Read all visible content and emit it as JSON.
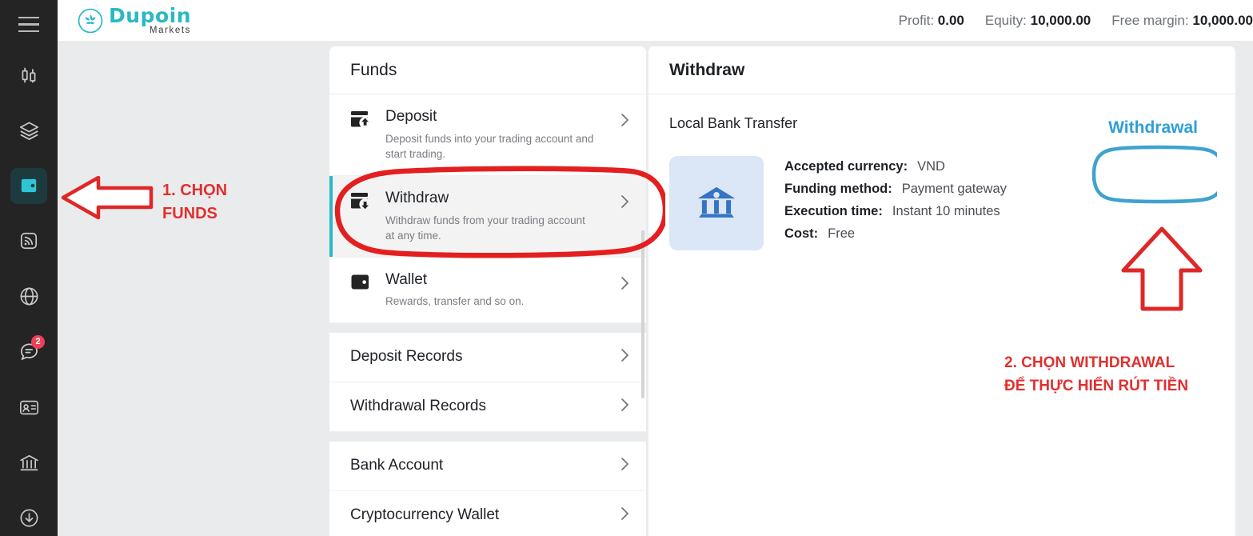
{
  "brand": {
    "name": "Dupoin",
    "sub": "Markets",
    "color": "#29b9c4"
  },
  "header": {
    "menu_icon": "hamburger-icon",
    "stats": [
      {
        "label": "Profit:",
        "value": "0.00"
      },
      {
        "label": "Equity:",
        "value": "10,000.00"
      },
      {
        "label": "Free margin:",
        "value": "10,000.00"
      }
    ]
  },
  "sidebar": {
    "items": [
      {
        "icon": "candlestick-chart-icon",
        "active": false
      },
      {
        "icon": "layers-icon",
        "active": false
      },
      {
        "icon": "wallet-icon",
        "active": true
      },
      {
        "icon": "signal-icon",
        "active": false
      },
      {
        "icon": "globe-icon",
        "active": false
      },
      {
        "icon": "chat-icon",
        "active": false,
        "badge": "2"
      },
      {
        "icon": "id-card-icon",
        "active": false
      },
      {
        "icon": "bank-icon",
        "active": false
      },
      {
        "icon": "download-circle-icon",
        "active": false
      }
    ]
  },
  "funds": {
    "title": "Funds",
    "primary_items": [
      {
        "icon": "deposit-icon",
        "title": "Deposit",
        "desc": "Deposit funds into your trading account and start trading.",
        "selected": false
      },
      {
        "icon": "withdraw-icon",
        "title": "Withdraw",
        "desc": "Withdraw funds from your trading account at any time.",
        "selected": true
      },
      {
        "icon": "wallet-icon",
        "title": "Wallet",
        "desc": "Rewards, transfer and so on.",
        "selected": false
      }
    ],
    "record_items": [
      {
        "title": "Deposit Records"
      },
      {
        "title": "Withdrawal Records"
      }
    ],
    "account_items": [
      {
        "title": "Bank Account"
      },
      {
        "title": "Cryptocurrency Wallet"
      }
    ],
    "chevron_icon": "chevron-right-icon"
  },
  "detail": {
    "title": "Withdraw",
    "method_label": "Local Bank Transfer",
    "method_icon": "bank-building-icon",
    "specs": [
      {
        "key": "Accepted currency:",
        "value": "VND"
      },
      {
        "key": "Funding method:",
        "value": "Payment gateway"
      },
      {
        "key": "Execution time:",
        "value": "Instant 10 minutes"
      },
      {
        "key": "Cost:",
        "value": "Free"
      }
    ],
    "action_label": "Withdrawal",
    "action_color": "#2e9fd6"
  },
  "annotations": {
    "color": "#e03030",
    "highlight_color": "#2e9fd6",
    "step1_line1": "1. CHỌN",
    "step1_line2": "FUNDS",
    "step2_line1": "2. CHỌN WITHDRAWAL",
    "step2_line2": "ĐỂ THỰC HIỂN RÚT TIỀN",
    "left_arrow_icon": "arrow-left-outline-icon",
    "up_arrow_icon": "arrow-up-outline-icon",
    "ellipse_icon": "ellipse-highlight-icon",
    "box_icon": "rounded-box-highlight-icon"
  }
}
